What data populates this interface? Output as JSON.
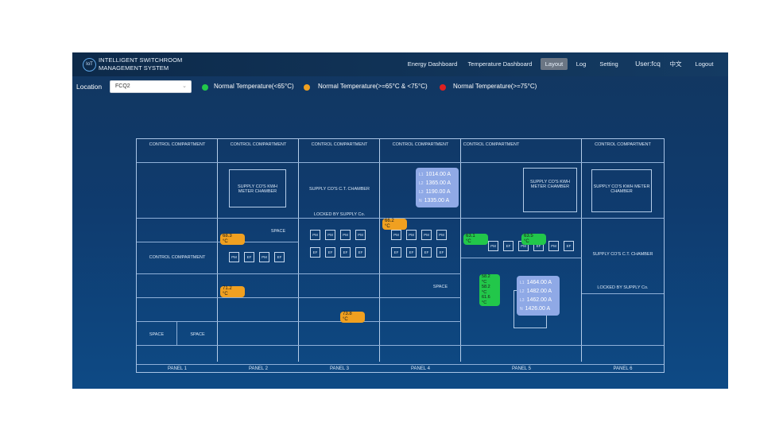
{
  "app": {
    "logo_text": "IoT",
    "title_line1": "INTELLIGENT SWITCHROOM",
    "title_line2": "MANAGEMENT SYSTEM"
  },
  "nav": {
    "energy": "Energy Dashboard",
    "temperature": "Temperature Dashboard",
    "layout": "Layout",
    "log": "Log",
    "setting": "Setting",
    "user": "User:fcq",
    "language": "中文",
    "logout": "Logout"
  },
  "toolbar": {
    "location_label": "Location",
    "location_value": "FCQ2",
    "legend": [
      {
        "label": "Normal Temperature(<65°C)",
        "color": "#22c74a"
      },
      {
        "label": "Normal Temperature(>=65°C & <75°C)",
        "color": "#f0a020"
      },
      {
        "label": "Normal Temperature(>=75°C)",
        "color": "#e02020"
      }
    ]
  },
  "layout": {
    "panels": [
      "PANEL 1",
      "PANEL 2",
      "PANEL 3",
      "PANEL 4",
      "PANEL 5",
      "PANEL 6"
    ],
    "compartments": {
      "control": "CONTROL COMPARTMENT",
      "supply_kwh": "SUPPLY CO'S KWH METER CHAMBER",
      "supply_ct": "SUPPLY CO'S C.T. CHAMBER",
      "locked": "LOCKED BY SUPPLY Co.",
      "space": "SPACE",
      "tpn": "TPN MCCB"
    },
    "sensors": [
      {
        "value": "68.3",
        "unit": "°C",
        "color": "orange"
      },
      {
        "value": "71.2",
        "unit": "°C",
        "color": "orange"
      },
      {
        "value": "66.2",
        "unit": "°C",
        "color": "orange"
      },
      {
        "value": "73.8",
        "unit": "°C",
        "color": "orange"
      },
      {
        "value": "63.1",
        "unit": "°C",
        "color": "green"
      },
      {
        "value": "63.5",
        "unit": "°C",
        "color": "green"
      },
      {
        "value": "58.2",
        "unit": "°C",
        "color": "green"
      },
      {
        "value": "58.2",
        "unit": "°C",
        "color": "green"
      },
      {
        "value": "61.6",
        "unit": "°C",
        "color": "green"
      }
    ],
    "meters": [
      {
        "rows": [
          {
            "phase": "L1",
            "value": "1014.00 A"
          },
          {
            "phase": "L2",
            "value": "1365.00 A"
          },
          {
            "phase": "L3",
            "value": "1190.00 A"
          },
          {
            "phase": "N",
            "value": "1335.00 A"
          }
        ]
      },
      {
        "rows": [
          {
            "phase": "L1",
            "value": "1464.00 A"
          },
          {
            "phase": "L2",
            "value": "1482.00 A"
          },
          {
            "phase": "L3",
            "value": "1462.00 A"
          },
          {
            "phase": "N",
            "value": "1426.00 A"
          }
        ]
      }
    ]
  }
}
